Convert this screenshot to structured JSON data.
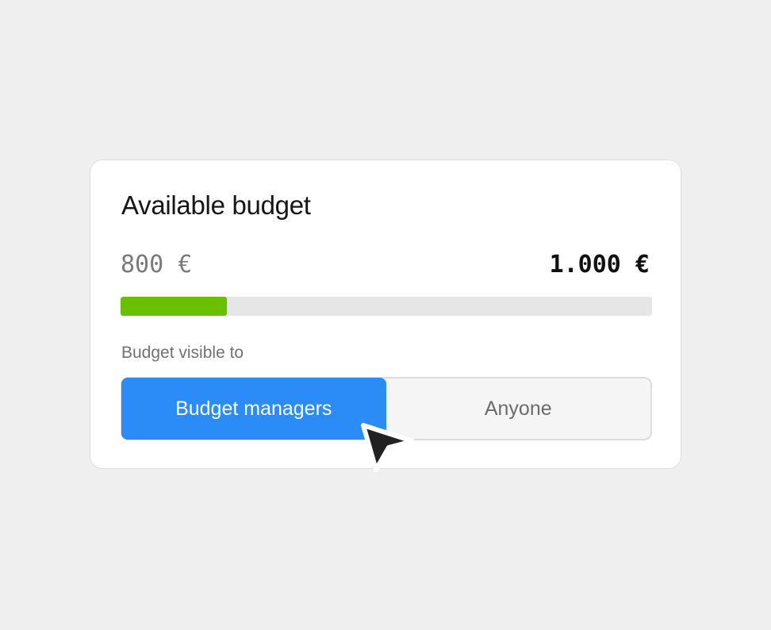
{
  "card": {
    "title": "Available budget",
    "spent": "800 €",
    "total": "1.000 €",
    "progress_fraction": 0.2,
    "visibility_label": "Budget visible to",
    "options": [
      {
        "label": "Budget managers",
        "selected": true
      },
      {
        "label": "Anyone",
        "selected": false
      }
    ]
  },
  "colors": {
    "accent": "#2b8cf7",
    "progress": "#6abf00",
    "track": "#e6e6e6"
  },
  "icons": {
    "cursor": "mouse-pointer-icon"
  }
}
